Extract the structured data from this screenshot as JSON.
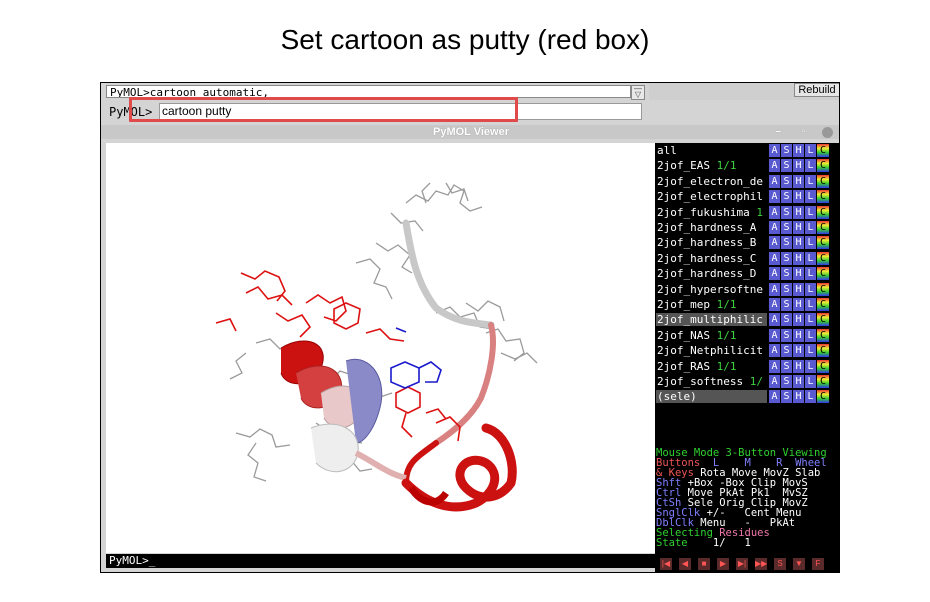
{
  "slide_title": "Set cartoon as putty  (red box)",
  "command": {
    "log_line": "PyMOL>cartoon automatic,",
    "prompt": "PyMOL>",
    "input_value": "cartoon putty",
    "rebuild_label": "Rebuild"
  },
  "viewer": {
    "title": "PyMOL Viewer",
    "bottom_prompt": "PyMOL>_"
  },
  "objects": [
    {
      "name": "all",
      "suffix": ""
    },
    {
      "name": "2jof_EAS ",
      "suffix": "1/1"
    },
    {
      "name": "2jof_electron_de",
      "suffix": ""
    },
    {
      "name": "2jof_electrophil",
      "suffix": ""
    },
    {
      "name": "2jof_fukushima ",
      "suffix": "1"
    },
    {
      "name": "2jof_hardness_A",
      "suffix": ""
    },
    {
      "name": "2jof_hardness_B",
      "suffix": ""
    },
    {
      "name": "2jof_hardness_C",
      "suffix": ""
    },
    {
      "name": "2jof_hardness_D",
      "suffix": ""
    },
    {
      "name": "2jof_hypersoftne",
      "suffix": ""
    },
    {
      "name": "2jof_mep ",
      "suffix": "1/1"
    },
    {
      "name": "2jof_multiphilic",
      "suffix": ""
    },
    {
      "name": "2jof_NAS ",
      "suffix": "1/1"
    },
    {
      "name": "2jof_Netphilicit",
      "suffix": ""
    },
    {
      "name": "2jof_RAS ",
      "suffix": "1/1"
    },
    {
      "name": "2jof_softness ",
      "suffix": "1/"
    },
    {
      "name": "(sele)",
      "suffix": ""
    }
  ],
  "object_buttons": [
    "A",
    "S",
    "H",
    "L",
    "C"
  ],
  "mouse_panel": {
    "mode_line": "Mouse Mode 3-Button Viewing",
    "buttons_label": "Buttons",
    "buttons_cols": "  L    M    R  Wheel",
    "keys_label": "& Keys",
    "keys_row": " Rota Move MovZ Slab",
    "shft_label": "Shft",
    "shft_row": " +Box -Box Clip MovS",
    "ctrl_label": "Ctrl",
    "ctrl_row": " Move PkAt Pk1  MvSZ",
    "ctsh_label": "CtSh",
    "ctsh_row": " Sele Orig Clip MovZ",
    "sngl_label": "SnglClk",
    "sngl_row": " +/-   Cent Menu",
    "dbl_label": "DblClk",
    "dbl_row": " Menu   -   PkAt",
    "selecting": "Selecting",
    "residues": "Residues",
    "state_label": "State",
    "state_value": "1/   1"
  },
  "player_buttons": [
    "|◀",
    "◀",
    "■",
    "▶",
    "▶|",
    "▶▶",
    "S",
    "▼",
    "F"
  ],
  "colors": {
    "highlight_box": "#e04a4a",
    "helix_red": "#cc1111",
    "helix_blue": "#6a6ab8"
  }
}
